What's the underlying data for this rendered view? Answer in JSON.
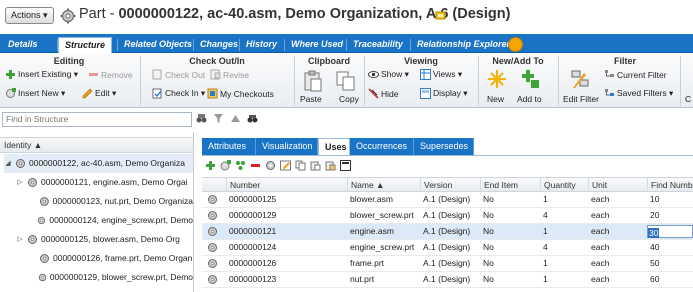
{
  "title": {
    "actions_label": "Actions ▾",
    "prefix": "Part - ",
    "name": "0000000122, ac-40.asm, Demo Organization, A.6 (Design)"
  },
  "tabs": [
    "Details",
    "Structure",
    "Related Objects",
    "Changes",
    "History",
    "Where Used",
    "Traceability",
    "Relationship Explorer"
  ],
  "active_tab": "Structure",
  "ribbon": {
    "groups": [
      "Editing",
      "Check Out/In",
      "Clipboard",
      "Viewing",
      "New/Add To",
      "Filter"
    ],
    "editing": {
      "insert_existing": "Insert Existing ▾",
      "remove": "Remove",
      "insert_new": "Insert New ▾",
      "edit": "Edit ▾"
    },
    "checkout": {
      "check_out": "Check Out",
      "revise": "Revise",
      "check_in": "Check In ▾",
      "my_checkouts": "My Checkouts"
    },
    "clipboard": {
      "paste": "Paste",
      "copy": "Copy"
    },
    "viewing": {
      "show": "Show ▾",
      "views": "Views ▾",
      "hide": "Hide",
      "display": "Display ▾"
    },
    "new_add": {
      "new": "New",
      "add_to": "Add to"
    },
    "filter": {
      "edit_filter": "Edit Filter",
      "current_filter": "Current Filter",
      "saved_filters": "Saved Filters ▾",
      "extra": "C"
    }
  },
  "left": {
    "find_placeholder": "Find in Structure",
    "header": "Identity ▲",
    "tree": [
      {
        "label": "0000000122, ac-40.asm, Demo Organiza",
        "indent": 0,
        "expander": "◢"
      },
      {
        "label": "0000000121, engine.asm, Demo Orgai",
        "indent": 1,
        "expander": "▷"
      },
      {
        "label": "0000000123, nut.prt, Demo Organiza",
        "indent": 2,
        "expander": ""
      },
      {
        "label": "0000000124, engine_screw.prt, Demo",
        "indent": 2,
        "expander": ""
      },
      {
        "label": "0000000125, blower.asm, Demo Org",
        "indent": 1,
        "expander": "▷"
      },
      {
        "label": "0000000126, frame.prt, Demo Organ",
        "indent": 2,
        "expander": ""
      },
      {
        "label": "0000000129, blower_screw.prt, Demo",
        "indent": 2,
        "expander": ""
      }
    ]
  },
  "subtabs": [
    "Attributes",
    "Visualization",
    "Uses",
    "Occurrences",
    "Supersedes"
  ],
  "active_subtab": "Uses",
  "grid": {
    "columns": [
      "Number",
      "Name ▲",
      "Version",
      "End Item",
      "Quantity",
      "Unit",
      "Find Numbe"
    ],
    "rows": [
      [
        "0000000125",
        "blower.asm",
        "A.1 (Design)",
        "No",
        "1",
        "each",
        "10"
      ],
      [
        "0000000129",
        "blower_screw.prt",
        "A.1 (Design)",
        "No",
        "4",
        "each",
        "20"
      ],
      [
        "0000000121",
        "engine.asm",
        "A.1 (Design)",
        "No",
        "1",
        "each",
        "30"
      ],
      [
        "0000000124",
        "engine_screw.prt",
        "A.1 (Design)",
        "No",
        "4",
        "each",
        "40"
      ],
      [
        "0000000126",
        "frame.prt",
        "A.1 (Design)",
        "No",
        "1",
        "each",
        "50"
      ],
      [
        "0000000123",
        "nut.prt",
        "A.1 (Design)",
        "No",
        "1",
        "each",
        "60"
      ]
    ],
    "selected_row": 2
  },
  "colors": {
    "tab_bar": "#1a74c6",
    "selection": "#dce9f6"
  }
}
